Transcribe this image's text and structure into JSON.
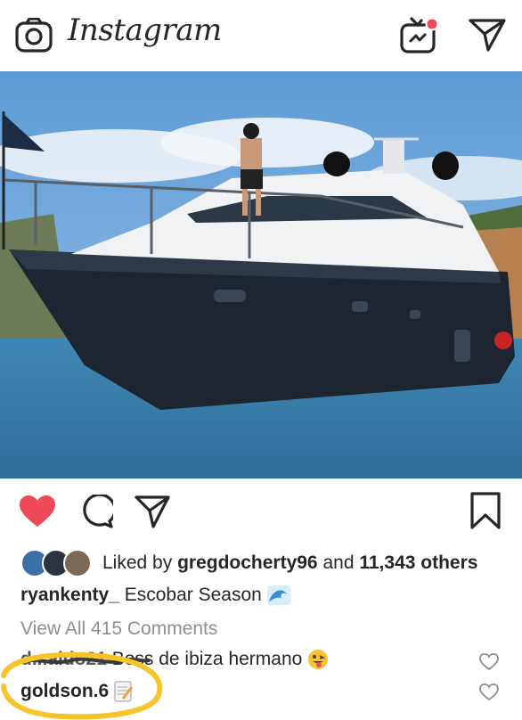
{
  "header": {
    "app_name": "Instagram",
    "camera_icon": "camera-icon",
    "igtv_icon": "igtv-icon",
    "direct_icon": "paper-plane-icon"
  },
  "post": {
    "liked_by_user": "gregdocherty96",
    "liked_prefix": "Liked by",
    "liked_and": "and",
    "liked_count": "11,343 others",
    "caption_user": "ryankenty_",
    "caption_text": "Escobar Season",
    "caption_emoji": "wave-emoji",
    "view_all_comments": "View All 415 Comments",
    "comments": [
      {
        "user": "d...aldo21",
        "text": "Boss de ibiza hermano",
        "emoji": "tongue-out-emoji"
      },
      {
        "user": "goldson.6",
        "text": "",
        "emoji": "memo-emoji"
      }
    ]
  },
  "colors": {
    "like_red": "#ed4956",
    "annotation_yellow": "#f7c52a",
    "sea": "#3b83b0",
    "sky": "#6ea9dd",
    "hull": "#1c2530"
  }
}
